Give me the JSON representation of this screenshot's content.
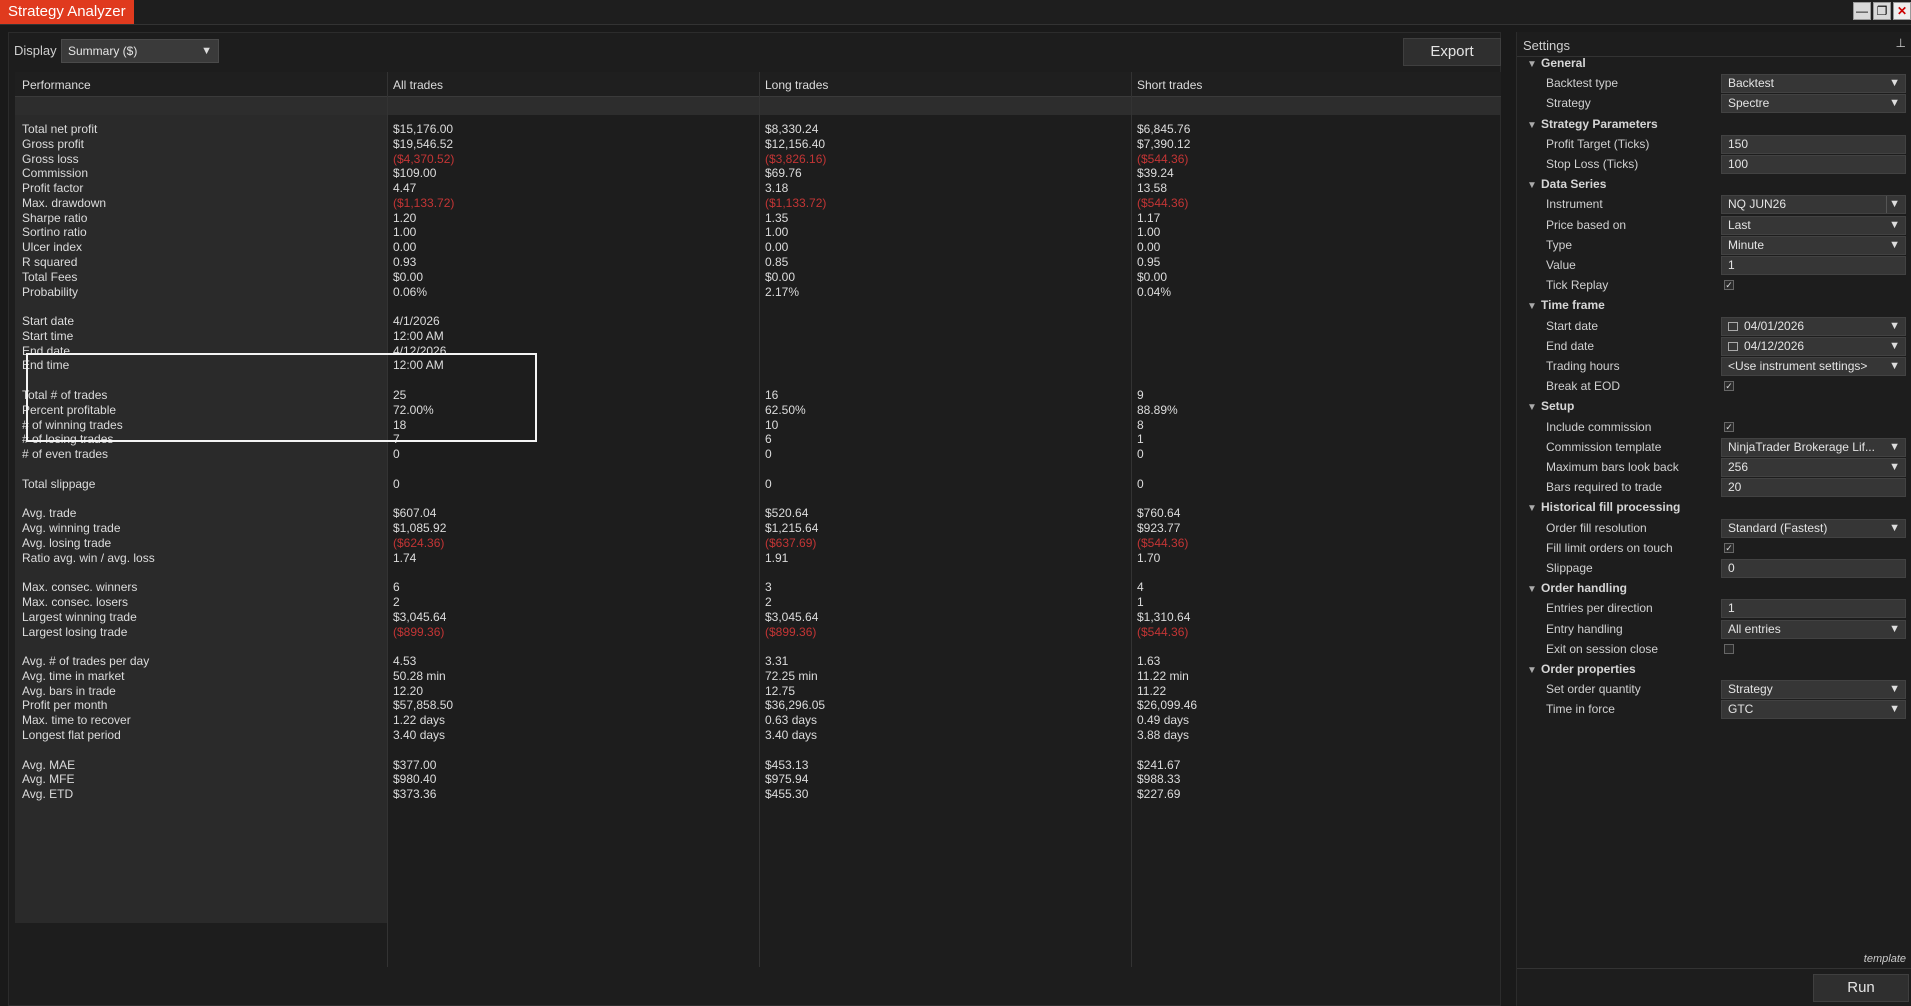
{
  "window": {
    "title": "Strategy Analyzer",
    "min": "—",
    "restore": "❐",
    "close": "✕"
  },
  "toolbar": {
    "display_label": "Display",
    "display_value": "Summary ($)",
    "export_label": "Export"
  },
  "table": {
    "headers": [
      "Performance",
      "All trades",
      "Long trades",
      "Short trades"
    ],
    "rows": [
      {
        "label": "Total net profit",
        "all": "$15,176.00",
        "long": "$8,330.24",
        "short": "$6,845.76"
      },
      {
        "label": "Gross profit",
        "all": "$19,546.52",
        "long": "$12,156.40",
        "short": "$7,390.12"
      },
      {
        "label": "Gross loss",
        "all": "($4,370.52)",
        "long": "($3,826.16)",
        "short": "($544.36)",
        "neg": true
      },
      {
        "label": "Commission",
        "all": "$109.00",
        "long": "$69.76",
        "short": "$39.24"
      },
      {
        "label": "Profit factor",
        "all": "4.47",
        "long": "3.18",
        "short": "13.58"
      },
      {
        "label": "Max. drawdown",
        "all": "($1,133.72)",
        "long": "($1,133.72)",
        "short": "($544.36)",
        "neg": true
      },
      {
        "label": "Sharpe ratio",
        "all": "1.20",
        "long": "1.35",
        "short": "1.17"
      },
      {
        "label": "Sortino ratio",
        "all": "1.00",
        "long": "1.00",
        "short": "1.00"
      },
      {
        "label": "Ulcer index",
        "all": "0.00",
        "long": "0.00",
        "short": "0.00"
      },
      {
        "label": "R squared",
        "all": "0.93",
        "long": "0.85",
        "short": "0.95"
      },
      {
        "label": "Total Fees",
        "all": "$0.00",
        "long": "$0.00",
        "short": "$0.00"
      },
      {
        "label": "Probability",
        "all": "0.06%",
        "long": "2.17%",
        "short": "0.04%"
      },
      {
        "label": "",
        "all": "",
        "long": "",
        "short": ""
      },
      {
        "label": "Start date",
        "all": "4/1/2026",
        "long": "",
        "short": ""
      },
      {
        "label": "Start time",
        "all": "12:00 AM",
        "long": "",
        "short": ""
      },
      {
        "label": "End date",
        "all": "4/12/2026",
        "long": "",
        "short": ""
      },
      {
        "label": "End time",
        "all": "12:00 AM",
        "long": "",
        "short": ""
      },
      {
        "label": "",
        "all": "",
        "long": "",
        "short": ""
      },
      {
        "label": "Total # of trades",
        "all": "25",
        "long": "16",
        "short": "9"
      },
      {
        "label": "Percent profitable",
        "all": "72.00%",
        "long": "62.50%",
        "short": "88.89%"
      },
      {
        "label": "# of winning trades",
        "all": "18",
        "long": "10",
        "short": "8"
      },
      {
        "label": "# of losing trades",
        "all": "7",
        "long": "6",
        "short": "1"
      },
      {
        "label": "# of even trades",
        "all": "0",
        "long": "0",
        "short": "0"
      },
      {
        "label": "",
        "all": "",
        "long": "",
        "short": ""
      },
      {
        "label": "Total slippage",
        "all": "0",
        "long": "0",
        "short": "0"
      },
      {
        "label": "",
        "all": "",
        "long": "",
        "short": ""
      },
      {
        "label": "Avg. trade",
        "all": "$607.04",
        "long": "$520.64",
        "short": "$760.64"
      },
      {
        "label": "Avg. winning trade",
        "all": "$1,085.92",
        "long": "$1,215.64",
        "short": "$923.77"
      },
      {
        "label": "Avg. losing trade",
        "all": "($624.36)",
        "long": "($637.69)",
        "short": "($544.36)",
        "neg": true
      },
      {
        "label": "Ratio avg. win / avg. loss",
        "all": "1.74",
        "long": "1.91",
        "short": "1.70"
      },
      {
        "label": "",
        "all": "",
        "long": "",
        "short": ""
      },
      {
        "label": "Max. consec. winners",
        "all": "6",
        "long": "3",
        "short": "4"
      },
      {
        "label": "Max. consec. losers",
        "all": "2",
        "long": "2",
        "short": "1"
      },
      {
        "label": "Largest winning trade",
        "all": "$3,045.64",
        "long": "$3,045.64",
        "short": "$1,310.64"
      },
      {
        "label": "Largest losing trade",
        "all": "($899.36)",
        "long": "($899.36)",
        "short": "($544.36)",
        "neg": true
      },
      {
        "label": "",
        "all": "",
        "long": "",
        "short": ""
      },
      {
        "label": "Avg. # of trades per day",
        "all": "4.53",
        "long": "3.31",
        "short": "1.63"
      },
      {
        "label": "Avg. time in market",
        "all": "50.28 min",
        "long": "72.25 min",
        "short": "11.22 min"
      },
      {
        "label": "Avg. bars in trade",
        "all": "12.20",
        "long": "12.75",
        "short": "11.22"
      },
      {
        "label": "Profit per month",
        "all": "$57,858.50",
        "long": "$36,296.05",
        "short": "$26,099.46"
      },
      {
        "label": "Max. time to recover",
        "all": "1.22 days",
        "long": "0.63 days",
        "short": "0.49 days"
      },
      {
        "label": "Longest flat period",
        "all": "3.40 days",
        "long": "3.40 days",
        "short": "3.88 days"
      },
      {
        "label": "",
        "all": "",
        "long": "",
        "short": ""
      },
      {
        "label": "Avg. MAE",
        "all": "$377.00",
        "long": "$453.13",
        "short": "$241.67"
      },
      {
        "label": "Avg. MFE",
        "all": "$980.40",
        "long": "$975.94",
        "short": "$988.33"
      },
      {
        "label": "Avg. ETD",
        "all": "$373.36",
        "long": "$455.30",
        "short": "$227.69"
      }
    ]
  },
  "settings": {
    "title": "Settings",
    "pin": "⊥",
    "template_label": "template",
    "run_label": "Run",
    "sections": [
      {
        "title": "General",
        "props": [
          {
            "label": "Backtest type",
            "kind": "dropdown",
            "value": "Backtest"
          },
          {
            "label": "Strategy",
            "kind": "dropdown",
            "value": "Spectre"
          }
        ]
      },
      {
        "title": "Strategy Parameters",
        "props": [
          {
            "label": "Profit Target (Ticks)",
            "kind": "text",
            "value": "150"
          },
          {
            "label": "Stop Loss (Ticks)",
            "kind": "text",
            "value": "100"
          }
        ]
      },
      {
        "title": "Data Series",
        "props": [
          {
            "label": "Instrument",
            "kind": "instrument",
            "value": "NQ JUN26"
          },
          {
            "label": "Price based on",
            "kind": "dropdown",
            "value": "Last"
          },
          {
            "label": "Type",
            "kind": "dropdown",
            "value": "Minute"
          },
          {
            "label": "Value",
            "kind": "text",
            "value": "1"
          },
          {
            "label": "Tick Replay",
            "kind": "checkbox",
            "checked": true
          }
        ]
      },
      {
        "title": "Time frame",
        "props": [
          {
            "label": "Start date",
            "kind": "date",
            "value": "04/01/2026"
          },
          {
            "label": "End date",
            "kind": "date",
            "value": "04/12/2026"
          },
          {
            "label": "Trading hours",
            "kind": "dropdown",
            "value": "<Use instrument settings>"
          },
          {
            "label": "Break at EOD",
            "kind": "checkbox",
            "checked": true
          }
        ]
      },
      {
        "title": "Setup",
        "props": [
          {
            "label": "Include commission",
            "kind": "checkbox",
            "checked": true
          },
          {
            "label": "Commission template",
            "kind": "dropdown",
            "value": "NinjaTrader Brokerage Lif..."
          },
          {
            "label": "Maximum bars look back",
            "kind": "dropdown",
            "value": "256"
          },
          {
            "label": "Bars required to trade",
            "kind": "text",
            "value": "20"
          }
        ]
      },
      {
        "title": "Historical fill processing",
        "props": [
          {
            "label": "Order fill resolution",
            "kind": "dropdown",
            "value": "Standard (Fastest)"
          },
          {
            "label": "Fill limit orders on touch",
            "kind": "checkbox",
            "checked": true
          },
          {
            "label": "Slippage",
            "kind": "text",
            "value": "0"
          }
        ]
      },
      {
        "title": "Order handling",
        "props": [
          {
            "label": "Entries per direction",
            "kind": "text",
            "value": "1"
          },
          {
            "label": "Entry handling",
            "kind": "dropdown",
            "value": "All entries"
          },
          {
            "label": "Exit on session close",
            "kind": "checkbox",
            "checked": false
          }
        ]
      },
      {
        "title": "Order properties",
        "props": [
          {
            "label": "Set order quantity",
            "kind": "dropdown",
            "value": "Strategy"
          },
          {
            "label": "Time in force",
            "kind": "dropdown",
            "value": "GTC"
          }
        ]
      }
    ]
  }
}
